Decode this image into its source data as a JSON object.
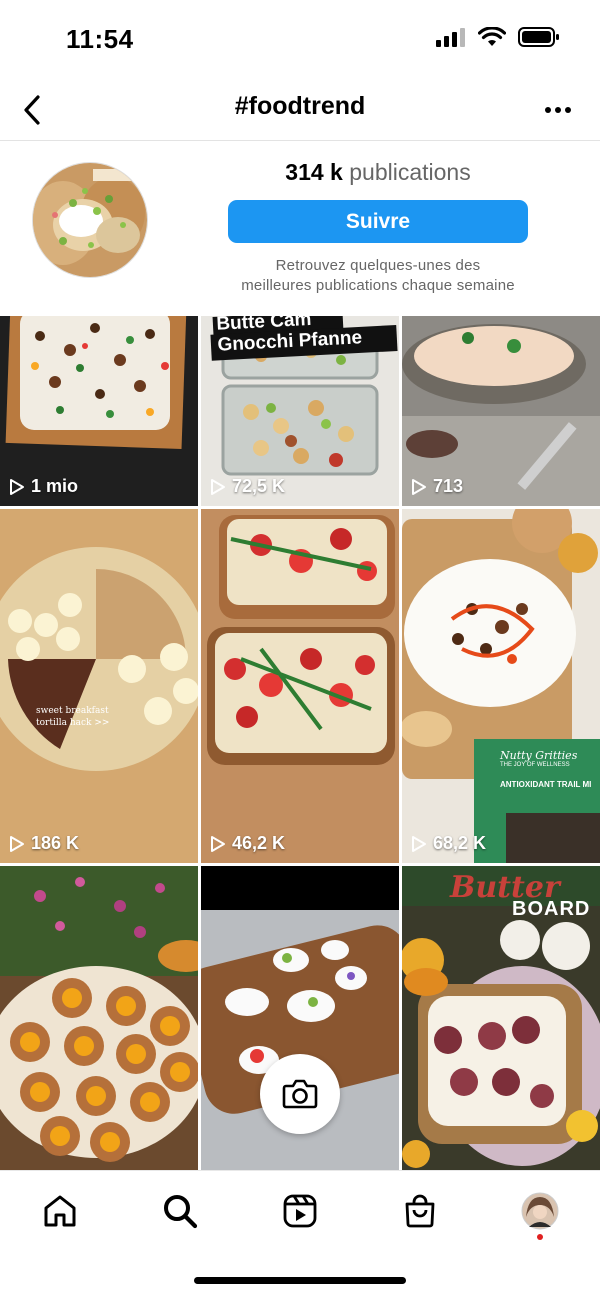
{
  "status": {
    "time": "11:54"
  },
  "header": {
    "title": "#foodtrend"
  },
  "profile": {
    "count": "314 k",
    "count_label": "publications",
    "follow_label": "Suivre",
    "description_line1": "Retrouvez quelques-unes des",
    "description_line2": "meilleures publications chaque semaine"
  },
  "grid": {
    "posts": [
      {
        "views": "1 mio"
      },
      {
        "views": "72,5 K",
        "overlay_line1": "Butte Cam",
        "overlay_line2": "Gnocchi Pfanne"
      },
      {
        "views": "713"
      },
      {
        "views": "186 K",
        "caption_line1": "sweet breakfast",
        "caption_line2": "tortilla hack >>"
      },
      {
        "views": "46,2 K"
      },
      {
        "views": "68,2 K",
        "package_brand": "Nutty Gritties",
        "package_tagline": "THE JOY OF WELLNESS",
        "package_product": "ANTIOXIDANT TRAIL MI"
      },
      {},
      {},
      {
        "overlay_word1": "Butter",
        "overlay_word2": "BOARD"
      }
    ]
  },
  "colors": {
    "accent": "#1c96f2",
    "notification_dot": "#e02020"
  },
  "icons": [
    "back-arrow-icon",
    "more-options-icon",
    "play-icon",
    "camera-icon",
    "home-icon",
    "search-icon",
    "reels-icon",
    "shop-icon",
    "profile-avatar-icon"
  ]
}
